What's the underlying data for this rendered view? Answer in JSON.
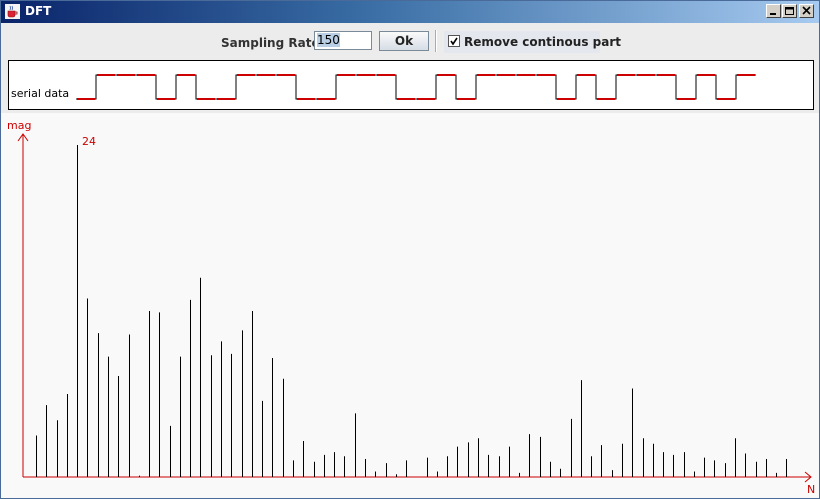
{
  "window": {
    "title": "DFT"
  },
  "toolbar": {
    "sampling_rate_label": "Sampling Rate:",
    "sampling_rate_value": "150",
    "ok_label": "Ok",
    "remove_label": "Remove continous part",
    "remove_checked": true
  },
  "serial": {
    "label": "serial data",
    "bits": [
      0,
      1,
      1,
      1,
      0,
      1,
      0,
      0,
      1,
      1,
      1,
      0,
      0,
      1,
      1,
      1,
      0,
      0,
      1,
      0,
      1,
      1,
      1,
      1,
      0,
      1,
      0,
      1,
      1,
      1,
      0,
      1,
      0,
      1
    ]
  },
  "chart_data": {
    "type": "bar",
    "ylabel": "mag",
    "xlabel": "N",
    "peak_label": "24",
    "ylim": [
      0,
      24
    ],
    "values": [
      3.0,
      5.2,
      4.1,
      6.0,
      24.0,
      12.9,
      10.4,
      8.7,
      7.3,
      10.3,
      0.1,
      12.0,
      11.9,
      3.7,
      8.7,
      12.8,
      14.4,
      8.8,
      9.8,
      8.9,
      10.6,
      12.0,
      5.5,
      8.6,
      7.1,
      1.2,
      2.6,
      1.1,
      1.6,
      1.8,
      1.5,
      4.6,
      1.3,
      0.4,
      1.0,
      0.2,
      1.2,
      0.0,
      1.4,
      0.4,
      1.5,
      2.2,
      2.5,
      2.8,
      1.6,
      1.5,
      2.2,
      0.3,
      3.1,
      2.9,
      1.1,
      0.6,
      4.2,
      7.0,
      1.5,
      2.3,
      0.5,
      2.4,
      6.4,
      2.8,
      2.4,
      1.8,
      1.6,
      1.8,
      0.4,
      1.4,
      1.2,
      1.0,
      2.8,
      1.7,
      1.1,
      1.3,
      0.3,
      1.3
    ]
  },
  "colors": {
    "axis": "#cc0000",
    "bar": "#000000",
    "signal": "#000000",
    "sample_dot": "#cc0000"
  }
}
